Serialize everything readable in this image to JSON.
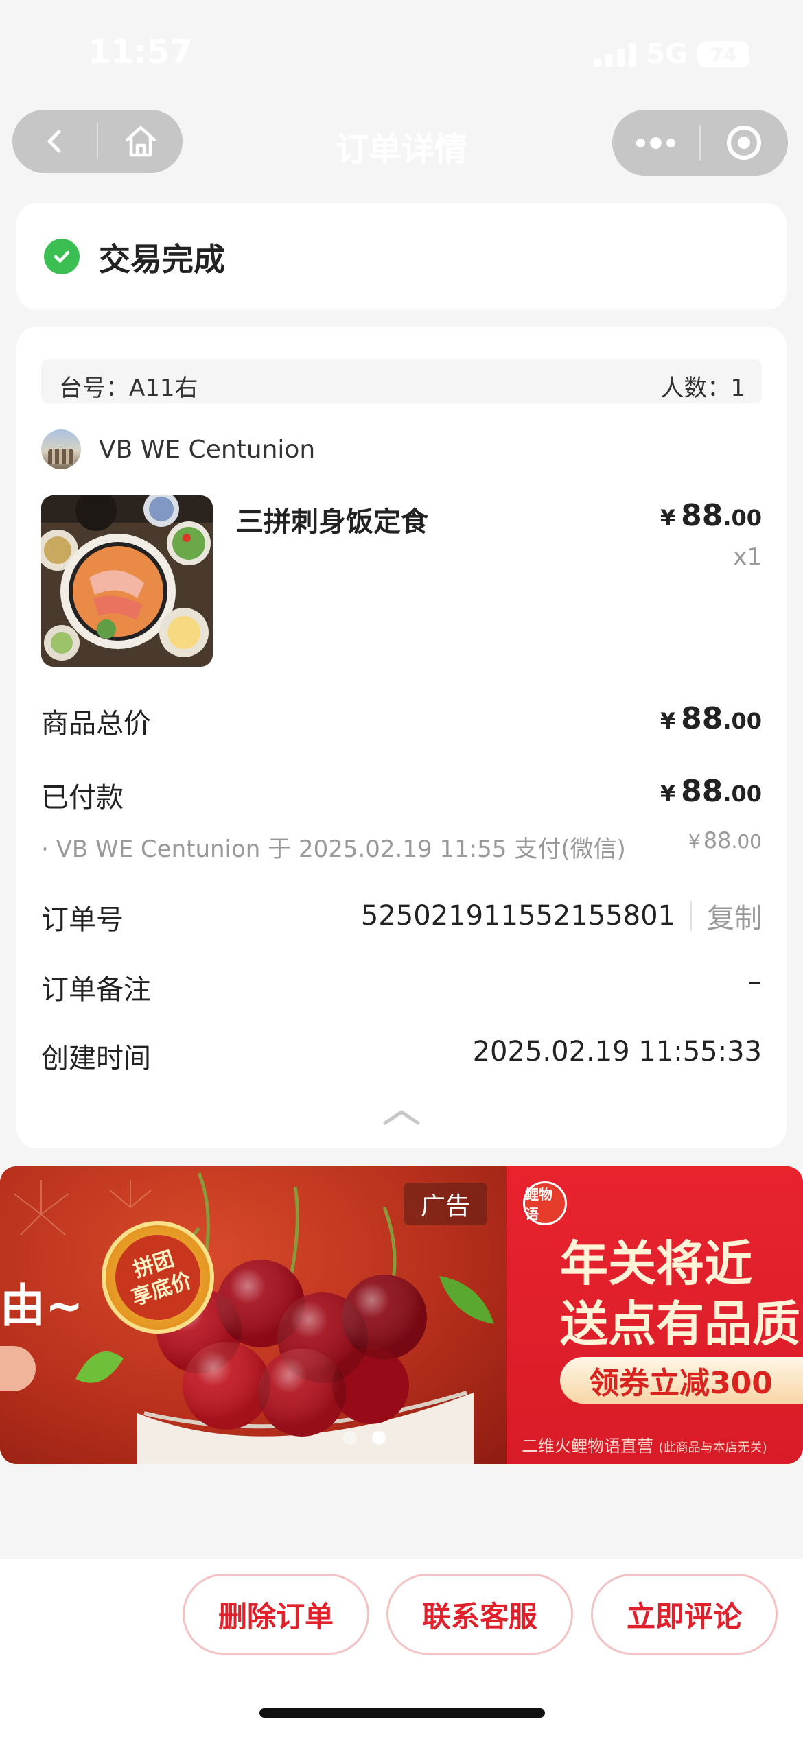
{
  "status_bar": {
    "time": "11:57",
    "network": "5G",
    "battery": "74"
  },
  "nav": {
    "title": "订单详情"
  },
  "order_status": {
    "text": "交易完成"
  },
  "table": {
    "table_no": "台号：A11右",
    "people": "人数：1"
  },
  "shop": {
    "name": "VB WE Centunion"
  },
  "product": {
    "name": "三拼刺身饭定食",
    "price_currency": "¥",
    "price_int": "88",
    "price_dec": ".00",
    "qty": "x1"
  },
  "summary": {
    "total_label": "商品总价",
    "total_currency": "¥",
    "total_int": "88",
    "total_dec": ".00",
    "paid_label": "已付款",
    "paid_currency": "¥",
    "paid_int": "88",
    "paid_dec": ".00",
    "pay_detail": "· VB WE Centunion 于 2025.02.19 11:55 支付(微信)",
    "pay_detail_currency": "¥",
    "pay_detail_int": "88",
    "pay_detail_dec": ".00",
    "order_no_label": "订单号",
    "order_no": "525021911552155801",
    "copy_label": "复制",
    "remark_label": "订单备注",
    "remark_value": "–",
    "created_label": "创建时间",
    "created_value": "2025.02.19 11:55:33"
  },
  "ad": {
    "left_text": "由~",
    "badge_line1": "拼团",
    "badge_line2": "享底价",
    "tag": "广告",
    "logo": "鲤物语",
    "headline1": "年关将近",
    "headline2": "送点有品质",
    "coupon": "领券立减300",
    "footer": "二维火鲤物语直营",
    "footer_note": "(此商品与本店无关)",
    "active_dot": 2
  },
  "actions": {
    "delete": "删除订单",
    "service": "联系客服",
    "review": "立即评论"
  },
  "colors": {
    "accent_red": "#e0212b",
    "success_green": "#3cbf52",
    "background": "#f5f5f5"
  }
}
